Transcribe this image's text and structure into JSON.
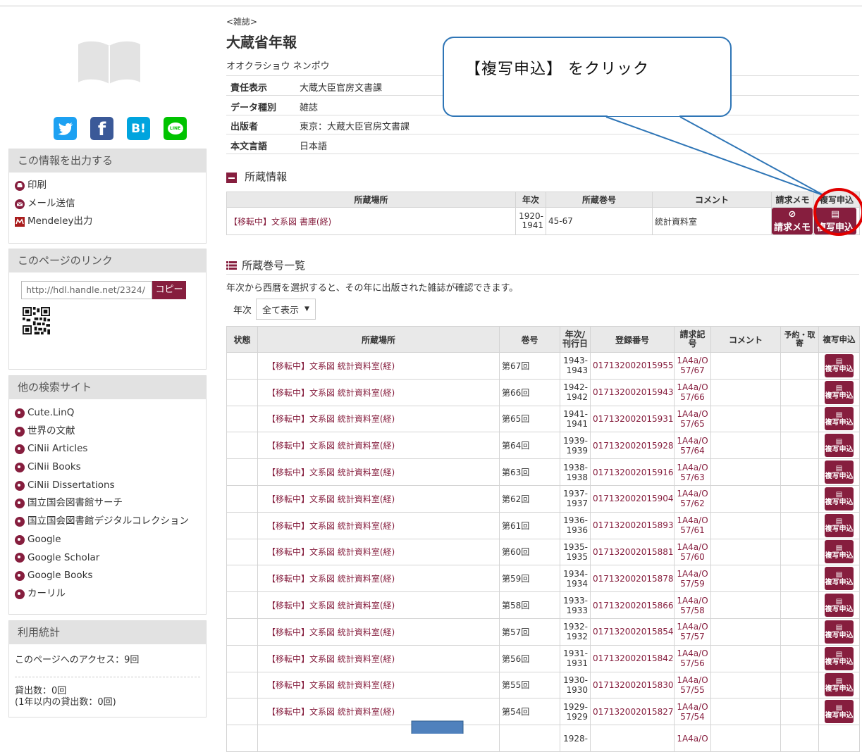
{
  "sidebar": {
    "social": [
      {
        "name": "twitter",
        "glyph": "",
        "color": "#1da1f2"
      },
      {
        "name": "facebook",
        "glyph": "f",
        "color": "#3b5998"
      },
      {
        "name": "hatena-bookmark",
        "glyph": "B!",
        "color": "#00a4de"
      },
      {
        "name": "line",
        "glyph": "LINE",
        "color": "#00c300"
      }
    ],
    "output": {
      "title": "この情報を出力する",
      "items": [
        "印刷",
        "メール送信",
        "Mendeley出力"
      ]
    },
    "link": {
      "title": "このページのリンク",
      "url": "http://hdl.handle.net/2324/",
      "copy_label": "コピー"
    },
    "other_sites": {
      "title": "他の検索サイト",
      "items": [
        "Cute.LinQ",
        "世界の文献",
        "CiNii Articles",
        "CiNii Books",
        "CiNii Dissertations",
        "国立国会図書館サーチ",
        "国立国会図書館デジタルコレクション",
        "Google",
        "Google Scholar",
        "Google Books",
        "カーリル"
      ]
    },
    "stats": {
      "title": "利用統計",
      "access": "このページへのアクセス：9回",
      "loans": "貸出数：0回",
      "loans_year": "(1年以内の貸出数：0回)"
    }
  },
  "record": {
    "type_label": "<雑誌>",
    "title": "大蔵省年報",
    "reading": "オオクラショウ ネンポウ",
    "meta": [
      {
        "label": "責任表示",
        "value": "大蔵大臣官房文書課"
      },
      {
        "label": "データ種別",
        "value": "雑誌"
      },
      {
        "label": "出版者",
        "value": "東京：大蔵大臣官房文書課"
      },
      {
        "label": "本文言語",
        "value": "日本語"
      }
    ]
  },
  "holdings": {
    "title": "所蔵情報",
    "headers": [
      "所蔵場所",
      "年次",
      "所蔵巻号",
      "コメント",
      "請求メモ",
      "複写申込"
    ],
    "row": {
      "location": "【移転中】文系図 書庫(経)",
      "year": "1920-\n1941",
      "volumes": "45-67",
      "comment": "統計資料室"
    },
    "memo_button": "請求メモ",
    "copy_button": "複写申込"
  },
  "volumes": {
    "title": "所蔵巻号一覧",
    "hint": "年次から西暦を選択すると、その年に出版された雑誌が確認できます。",
    "year_label": "年次",
    "year_select": "全て表示",
    "headers": [
      "状態",
      "所蔵場所",
      "巻号",
      "年次/刊行日",
      "登録番号",
      "請求記号",
      "コメント",
      "予約・取寄",
      "複写申込"
    ],
    "row_button": "複写申込",
    "rows": [
      {
        "location": "【移転中】文系図 統計資料室(経)",
        "vol": "第67回",
        "y1": "1943-",
        "y2": "1943",
        "reg": "017132002015955",
        "call1": "1A4a/O",
        "call2": "57/67"
      },
      {
        "location": "【移転中】文系図 統計資料室(経)",
        "vol": "第66回",
        "y1": "1942-",
        "y2": "1942",
        "reg": "017132002015943",
        "call1": "1A4a/O",
        "call2": "57/66"
      },
      {
        "location": "【移転中】文系図 統計資料室(経)",
        "vol": "第65回",
        "y1": "1941-",
        "y2": "1941",
        "reg": "017132002015931",
        "call1": "1A4a/O",
        "call2": "57/65"
      },
      {
        "location": "【移転中】文系図 統計資料室(経)",
        "vol": "第64回",
        "y1": "1939-",
        "y2": "1939",
        "reg": "017132002015928",
        "call1": "1A4a/O",
        "call2": "57/64"
      },
      {
        "location": "【移転中】文系図 統計資料室(経)",
        "vol": "第63回",
        "y1": "1938-",
        "y2": "1938",
        "reg": "017132002015916",
        "call1": "1A4a/O",
        "call2": "57/63"
      },
      {
        "location": "【移転中】文系図 統計資料室(経)",
        "vol": "第62回",
        "y1": "1937-",
        "y2": "1937",
        "reg": "017132002015904",
        "call1": "1A4a/O",
        "call2": "57/62"
      },
      {
        "location": "【移転中】文系図 統計資料室(経)",
        "vol": "第61回",
        "y1": "1936-",
        "y2": "1936",
        "reg": "017132002015893",
        "call1": "1A4a/O",
        "call2": "57/61"
      },
      {
        "location": "【移転中】文系図 統計資料室(経)",
        "vol": "第60回",
        "y1": "1935-",
        "y2": "1935",
        "reg": "017132002015881",
        "call1": "1A4a/O",
        "call2": "57/60"
      },
      {
        "location": "【移転中】文系図 統計資料室(経)",
        "vol": "第59回",
        "y1": "1934-",
        "y2": "1934",
        "reg": "017132002015878",
        "call1": "1A4a/O",
        "call2": "57/59"
      },
      {
        "location": "【移転中】文系図 統計資料室(経)",
        "vol": "第58回",
        "y1": "1933-",
        "y2": "1933",
        "reg": "017132002015866",
        "call1": "1A4a/O",
        "call2": "57/58"
      },
      {
        "location": "【移転中】文系図 統計資料室(経)",
        "vol": "第57回",
        "y1": "1932-",
        "y2": "1932",
        "reg": "017132002015854",
        "call1": "1A4a/O",
        "call2": "57/57"
      },
      {
        "location": "【移転中】文系図 統計資料室(経)",
        "vol": "第56回",
        "y1": "1931-",
        "y2": "1931",
        "reg": "017132002015842",
        "call1": "1A4a/O",
        "call2": "57/56"
      },
      {
        "location": "【移転中】文系図 統計資料室(経)",
        "vol": "第55回",
        "y1": "1930-",
        "y2": "1930",
        "reg": "017132002015830",
        "call1": "1A4a/O",
        "call2": "57/55"
      },
      {
        "location": "【移転中】文系図 統計資料室(経)",
        "vol": "第54回",
        "y1": "1929-",
        "y2": "1929",
        "reg": "017132002015827",
        "call1": "1A4a/O",
        "call2": "57/54"
      },
      {
        "location": "",
        "vol": "",
        "y1": "1928-",
        "y2": "",
        "reg": "",
        "call1": "1A4a/O",
        "call2": ""
      }
    ]
  },
  "annotation": {
    "callout_text": "【複写申込】 をクリック",
    "callout_color": "#2e75b6",
    "highlight_color": "#e00000"
  },
  "colors": {
    "accent": "#861e3e"
  }
}
